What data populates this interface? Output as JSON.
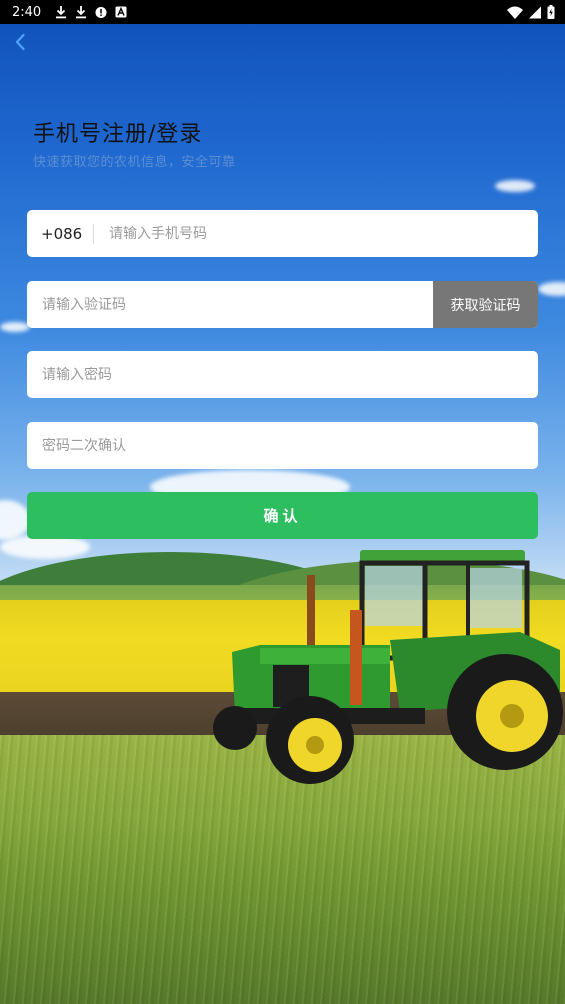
{
  "status_bar": {
    "time": "2:40",
    "left_icons": [
      "download-icon",
      "download-icon",
      "alert-icon",
      "font-icon"
    ],
    "right_icons": [
      "wifi-icon",
      "signal-icon",
      "battery-charging-icon"
    ]
  },
  "header": {
    "back_icon": "chevron-left-icon",
    "title": "手机号注册/登录",
    "subtitle": "快速获取您的农机信息，安全可靠"
  },
  "form": {
    "country_code": "+086",
    "phone_placeholder": "请输入手机号码",
    "code_placeholder": "请输入验证码",
    "get_code_label": "获取验证码",
    "password_placeholder": "请输入密码",
    "confirm_password_placeholder": "密码二次确认",
    "confirm_label": "确认"
  },
  "colors": {
    "accent_green": "#2dbe5f",
    "back_icon_blue": "#4da3ff",
    "get_code_gray": "#777777"
  }
}
